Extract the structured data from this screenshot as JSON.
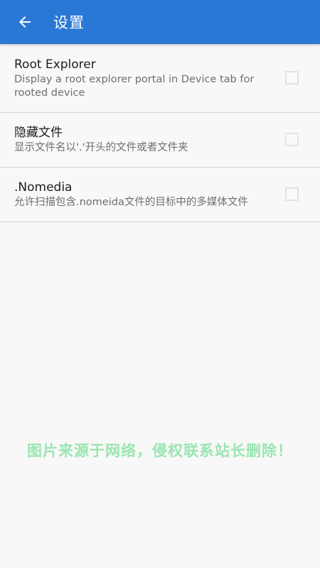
{
  "appbar": {
    "title": "设置",
    "back_icon": "arrow-back-icon"
  },
  "settings": [
    {
      "title": "Root Explorer",
      "subtitle": "Display a root explorer portal in Device tab for rooted device",
      "checked": false
    },
    {
      "title": "隐藏文件",
      "subtitle": "显示文件名以'.'开头的文件或者文件夹",
      "checked": false
    },
    {
      "title": ".Nomedia",
      "subtitle": "允许扫描包含.nomeida文件的目标中的多媒体文件",
      "checked": false
    }
  ],
  "watermark": "图片来源于网络，侵权联系站长删除！",
  "colors": {
    "appbar": "#2a78d6",
    "background": "#f8f8f8",
    "watermark": "#8ee5a8"
  }
}
